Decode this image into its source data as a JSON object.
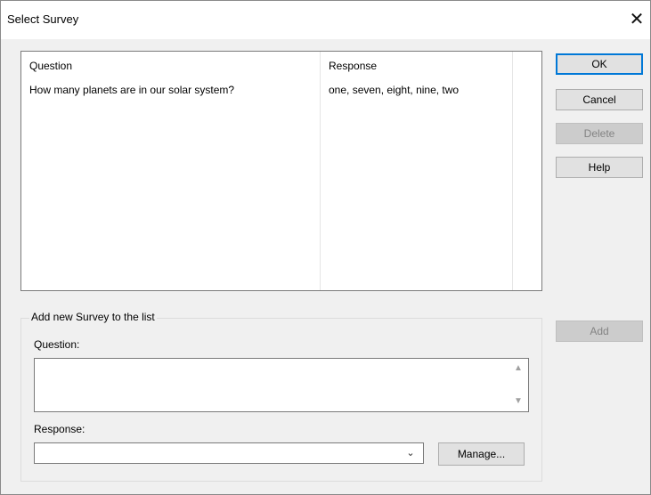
{
  "window": {
    "title": "Select Survey",
    "close_glyph": "✕"
  },
  "list": {
    "columns": [
      "Question",
      "Response"
    ],
    "rows": [
      {
        "question": "How many planets are in our solar system?",
        "response": "one, seven, eight, nine, two"
      }
    ]
  },
  "buttons": {
    "ok": "OK",
    "cancel": "Cancel",
    "delete": "Delete",
    "help": "Help",
    "add": "Add",
    "manage": "Manage..."
  },
  "group": {
    "legend": "Add new Survey to the list",
    "question_label": "Question:",
    "question_value": "",
    "response_label": "Response:",
    "response_value": ""
  },
  "icons": {
    "scroll_up": "scroll-up-icon",
    "scroll_down": "scroll-down-icon",
    "dropdown": "chevron-down-icon"
  },
  "colors": {
    "default_button_border": "#0078d7",
    "dialog_bg": "#f0f0f0",
    "disabled_text": "#838383"
  }
}
